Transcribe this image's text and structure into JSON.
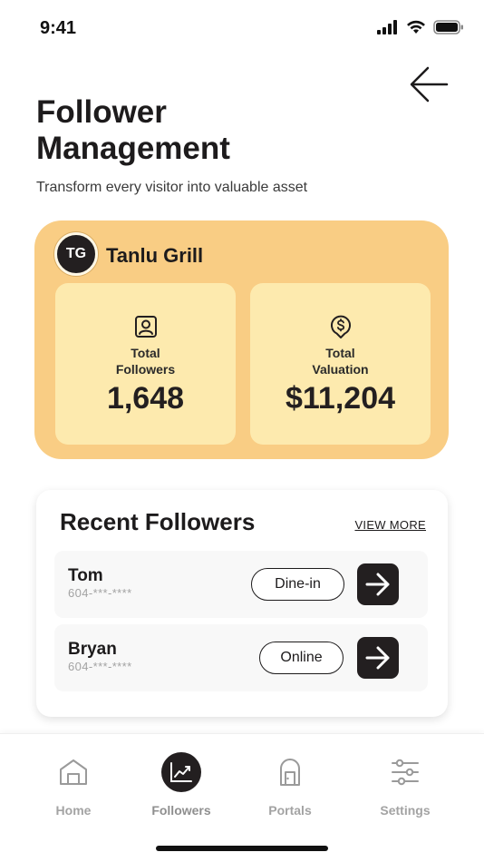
{
  "status_bar": {
    "time": "9:41"
  },
  "header": {
    "title": "Follower Management",
    "subtitle": "Transform every visitor into valuable asset",
    "back_icon": "arrow-left-icon"
  },
  "business": {
    "initials": "TG",
    "name": "Tanlu Grill",
    "stats": [
      {
        "label": "Total\nFollowers",
        "value": "1,648",
        "icon": "user-square-icon"
      },
      {
        "label": "Total\nValuation",
        "value": "$11,204",
        "icon": "dollar-pin-icon"
      }
    ],
    "colors": {
      "card": "#f9cd84",
      "stat_box": "#fdeaae"
    }
  },
  "recent_followers": {
    "title": "Recent Followers",
    "view_more": "VIEW MORE",
    "items": [
      {
        "name": "Tom",
        "phone": "604-***-****",
        "type": "Dine-in"
      },
      {
        "name": "Bryan",
        "phone": "604-***-****",
        "type": "Online"
      }
    ]
  },
  "nav": {
    "items": [
      {
        "label": "Home",
        "icon": "home-icon",
        "active": false
      },
      {
        "label": "Followers",
        "icon": "chart-line-icon",
        "active": true
      },
      {
        "label": "Portals",
        "icon": "door-icon",
        "active": false
      },
      {
        "label": "Settings",
        "icon": "sliders-icon",
        "active": false
      }
    ]
  }
}
